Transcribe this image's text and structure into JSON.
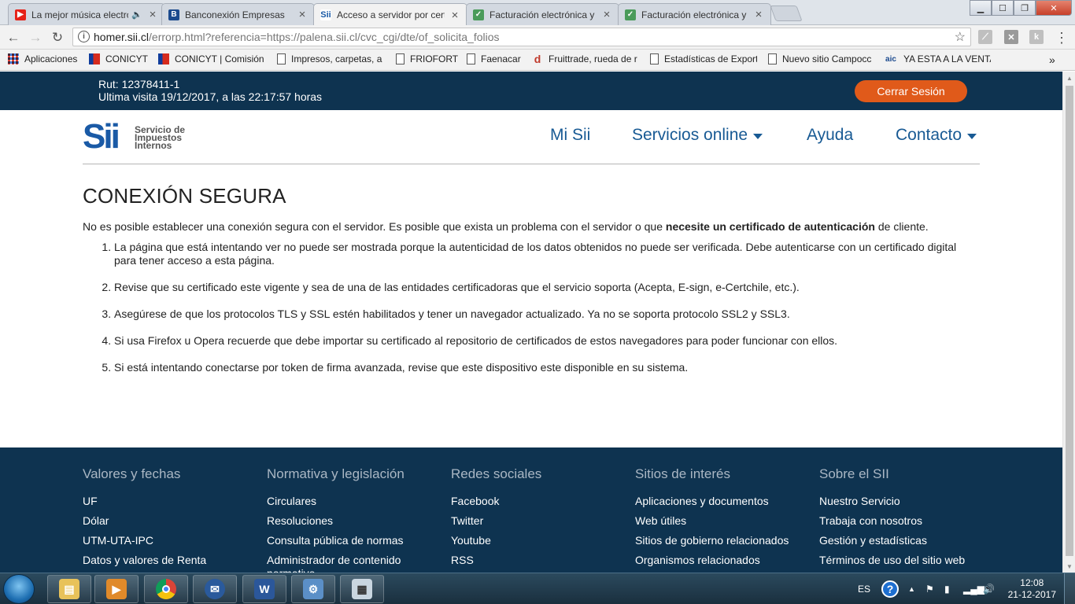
{
  "browser": {
    "tabs": [
      {
        "title": "La mejor música electrónica",
        "favicon": "youtube-icon",
        "color": "#e62117"
      },
      {
        "title": "Banconexión Empresas",
        "favicon": "bank-icon",
        "color": "#1b4a8e"
      },
      {
        "title": "Acceso a servidor por certificado",
        "favicon": "sii-icon",
        "color": "#1a5aa6"
      },
      {
        "title": "Facturación electrónica y",
        "favicon": "factura-icon",
        "color": "#4a9b5a"
      },
      {
        "title": "Facturación electrónica y",
        "favicon": "factura-icon",
        "color": "#4a9b5a"
      }
    ],
    "url_host": "homer.sii.cl",
    "url_path": "/errorp.html?referencia=https://palena.sii.cl/cvc_cgi/dte/of_solicita_folios",
    "bookmarks": [
      {
        "label": "Aplicaciones",
        "icon": "apps-grid-icon"
      },
      {
        "label": "CONICYT",
        "icon": "flag-icon"
      },
      {
        "label": "CONICYT | Comisión",
        "icon": "flag-icon"
      },
      {
        "label": "Impresos, carpetas, a",
        "icon": "page-icon"
      },
      {
        "label": "FRIOFORT",
        "icon": "page-icon"
      },
      {
        "label": "Faenacar",
        "icon": "page-icon"
      },
      {
        "label": "Fruittrade, rueda de r",
        "icon": "d-icon"
      },
      {
        "label": "Estadísticas de Export",
        "icon": "page-icon"
      },
      {
        "label": "Nuevo sitio Campocc",
        "icon": "page-icon"
      },
      {
        "label": "YA ESTA A LA VENTA",
        "icon": "aic-icon"
      }
    ],
    "overflow": "»",
    "ext_k": "k"
  },
  "site": {
    "rut": "Rut: 12378411-1",
    "last_visit": "Ultima visita 19/12/2017, a las 22:17:57 horas",
    "logout_label": "Cerrar Sesión",
    "logo_mark": "Sii",
    "logo_line1": "Servicio de",
    "logo_line2": "Impuestos",
    "logo_line3": "Internos",
    "nav": [
      {
        "label": "Mi Sii",
        "dropdown": false
      },
      {
        "label": "Servicios online",
        "dropdown": true
      },
      {
        "label": "Ayuda",
        "dropdown": false
      },
      {
        "label": "Contacto",
        "dropdown": true
      }
    ]
  },
  "content": {
    "title": "CONEXIÓN SEGURA",
    "intro_before": "No es posible establecer una conexión segura con el servidor. Es posible que exista un problema con el servidor o que ",
    "intro_bold": "necesite un certificado de autenticación",
    "intro_after": " de cliente.",
    "items": [
      "La página que está intentando ver no puede ser mostrada porque la autenticidad de los datos obtenidos no puede ser verificada. Debe autenticarse con un certificado digital para tener acceso a esta página.",
      "Revise que su certificado este vigente y sea de una de las entidades certificadoras que el servicio soporta (Acepta, E-sign, e-Certchile, etc.).",
      "Asegúrese de que los protocolos TLS y SSL estén habilitados y tener un navegador actualizado. Ya no se soporta protocolo SSL2 y SSL3.",
      "Si usa Firefox u Opera recuerde que debe importar su certificado al repositorio de certificados de estos navegadores para poder funcionar con ellos.",
      "Si está intentando conectarse por token de firma avanzada, revise que este dispositivo este disponible en su sistema."
    ]
  },
  "footer": {
    "columns": [
      {
        "heading": "Valores y fechas",
        "links": [
          "UF",
          "Dólar",
          "UTM-UTA-IPC",
          "Datos y valores de Renta"
        ]
      },
      {
        "heading": "Normativa y legislación",
        "links": [
          "Circulares",
          "Resoluciones",
          "Consulta pública de normas",
          "Administrador de contenido normativo"
        ]
      },
      {
        "heading": "Redes sociales",
        "links": [
          "Facebook",
          "Twitter",
          "Youtube",
          "RSS"
        ]
      },
      {
        "heading": "Sitios de interés",
        "links": [
          "Aplicaciones y documentos",
          "Web útiles",
          "Sitios de gobierno relacionados",
          "Organismos relacionados"
        ]
      },
      {
        "heading": "Sobre el SII",
        "links": [
          "Nuestro Servicio",
          "Trabaja con nosotros",
          "Gestión y estadísticas",
          "Términos de uso del sitio web"
        ]
      }
    ]
  },
  "taskbar": {
    "language": "ES",
    "time": "12:08",
    "date": "21-12-2017"
  }
}
